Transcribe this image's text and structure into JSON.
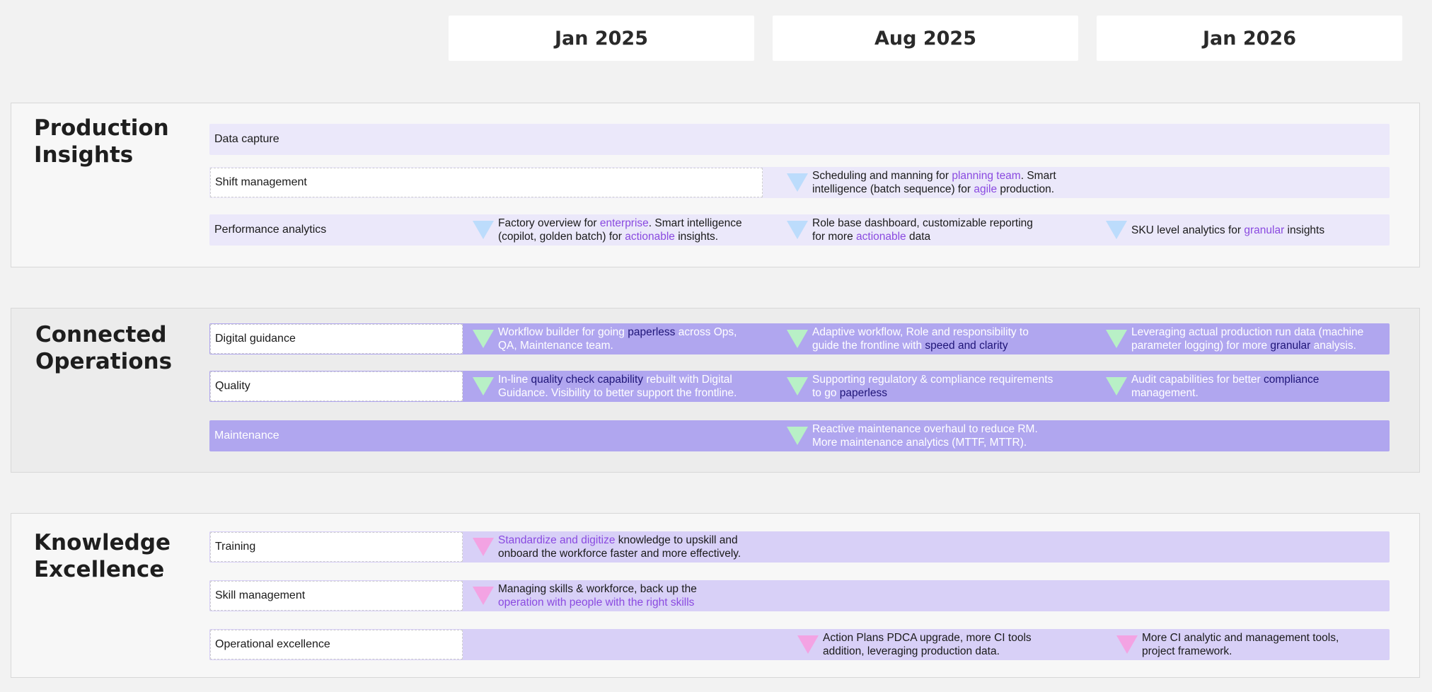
{
  "columns": [
    "Jan 2025",
    "Aug 2025",
    "Jan 2026"
  ],
  "colors": {
    "page_bg": "#f2f2f2",
    "section_light_bg": "#f7f7f7",
    "section_grey_bg": "#ececec",
    "lavender_light": "#ebe8fa",
    "lavender_mid": "#d8d0f7",
    "lavender_dark": "#b0a6ef",
    "highlight_purple": "#8a4ae0",
    "highlight_dark": "#1f1578",
    "triangle_blue": "#bcdcfc",
    "triangle_green": "#b8f0c6",
    "triangle_pink": "#f3a3e3"
  },
  "sections": {
    "production": {
      "title_line1": "Production",
      "title_line2": "Insights",
      "rows": {
        "data_capture": {
          "label": "Data capture"
        },
        "shift": {
          "label": "Shift management",
          "items": [
            {
              "icon": "blue-triangle-icon",
              "parts": [
                "Scheduling and manning for ",
                "planning team",
                ". Smart",
                "intelligence (batch sequence) for ",
                "agile",
                " production."
              ]
            }
          ]
        },
        "performance": {
          "label": "Performance analytics",
          "items": [
            {
              "icon": "blue-triangle-icon",
              "parts": [
                "Factory overview for ",
                "enterprise",
                ". Smart intelligence",
                "(copilot, golden batch) for ",
                "actionable",
                " insights."
              ]
            },
            {
              "icon": "blue-triangle-icon",
              "parts": [
                "Role base dashboard, customizable reporting",
                "for more ",
                "actionable",
                " data"
              ]
            },
            {
              "icon": "blue-triangle-icon",
              "parts": [
                "SKU level analytics for ",
                "granular",
                " insights"
              ]
            }
          ]
        }
      }
    },
    "connected": {
      "title_line1": "Connected",
      "title_line2": "Operations",
      "rows": {
        "digital": {
          "label": "Digital guidance",
          "items": [
            {
              "icon": "green-triangle-icon",
              "parts": [
                "Workflow builder for going ",
                "paperless",
                " across Ops,",
                "QA, Maintenance team."
              ]
            },
            {
              "icon": "green-triangle-icon",
              "parts": [
                "Adaptive workflow, Role and responsibility to",
                "guide the frontline with ",
                "speed and clarity"
              ]
            },
            {
              "icon": "green-triangle-icon",
              "parts": [
                "Leveraging actual production run data (machine",
                "parameter logging) for more ",
                "granular",
                " analysis."
              ]
            }
          ]
        },
        "quality": {
          "label": "Quality",
          "items": [
            {
              "icon": "green-triangle-icon",
              "parts": [
                "In-line ",
                "quality check capability",
                " rebuilt with Digital",
                "Guidance. Visibility to better support the frontline."
              ]
            },
            {
              "icon": "green-triangle-icon",
              "parts": [
                "Supporting regulatory & compliance requirements",
                "to go ",
                "paperless"
              ]
            },
            {
              "icon": "green-triangle-icon",
              "parts": [
                "Audit capabilities for better ",
                "compliance",
                "management."
              ]
            }
          ]
        },
        "maintenance": {
          "label": "Maintenance",
          "items": [
            {
              "icon": "green-triangle-icon",
              "parts": [
                "Reactive maintenance overhaul to reduce RM.",
                "More maintenance analytics (MTTF, MTTR)."
              ]
            }
          ]
        }
      }
    },
    "knowledge": {
      "title_line1": "Knowledge",
      "title_line2": "Excellence",
      "rows": {
        "training": {
          "label": "Training",
          "items": [
            {
              "icon": "pink-triangle-icon",
              "parts": [
                "Standardize and digitize",
                " knowledge to upskill and",
                "onboard the workforce faster and more effectively."
              ]
            }
          ]
        },
        "skill": {
          "label": "Skill management",
          "items": [
            {
              "icon": "pink-triangle-icon",
              "parts": [
                "Managing skills & workforce, back up the",
                "operation with people with the right skills"
              ]
            }
          ]
        },
        "opex": {
          "label": "Operational excellence",
          "items": [
            {
              "icon": "pink-triangle-icon",
              "parts": [
                "Action Plans PDCA upgrade, more CI tools",
                "addition, leveraging production data."
              ]
            },
            {
              "icon": "pink-triangle-icon",
              "parts": [
                "More CI analytic and management tools,",
                "project framework."
              ]
            }
          ]
        }
      }
    }
  }
}
